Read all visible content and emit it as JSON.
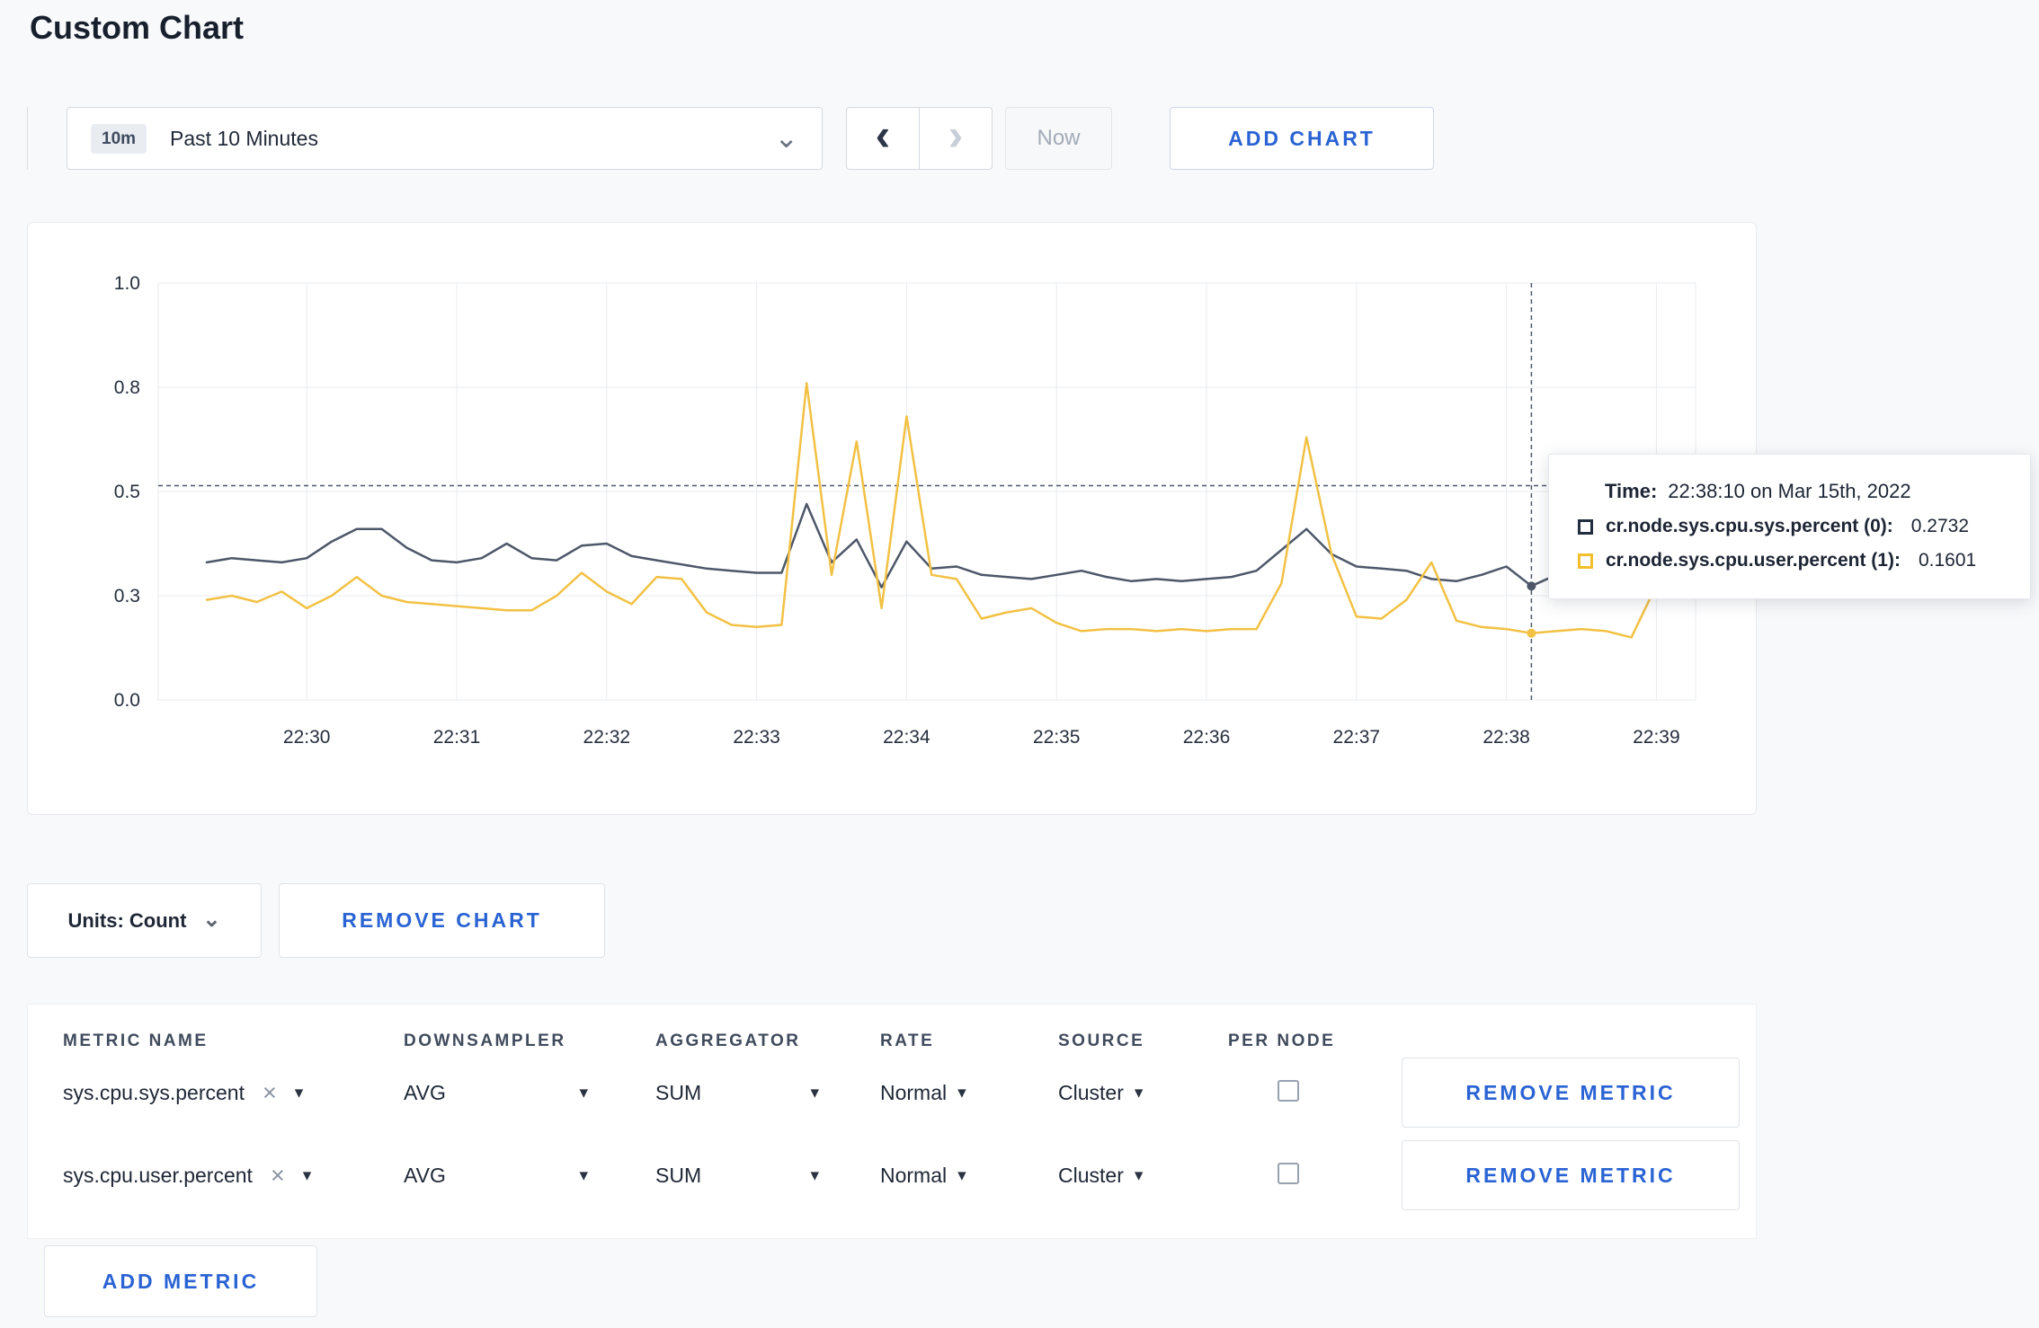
{
  "page": {
    "title": "Custom Chart"
  },
  "icons": {
    "chevron_down": "⌄",
    "chevron_left": "‹",
    "chevron_right": "›",
    "caret_down": "▾",
    "close": "×"
  },
  "toolbar": {
    "time_range": {
      "badge": "10m",
      "label": "Past 10 Minutes"
    },
    "now_label": "Now",
    "add_chart_label": "ADD CHART"
  },
  "chart_data": {
    "type": "line",
    "title": "",
    "xlabel": "",
    "ylabel": "",
    "ylim": [
      0,
      1
    ],
    "grid": true,
    "x_ticks": [
      "22:30",
      "22:31",
      "22:32",
      "22:33",
      "22:34",
      "22:35",
      "22:36",
      "22:37",
      "22:38",
      "22:39"
    ],
    "y_ticks": [
      {
        "value": 0.0,
        "label": "0.0"
      },
      {
        "value": 0.25,
        "label": "0.3"
      },
      {
        "value": 0.5,
        "label": "0.5"
      },
      {
        "value": 0.75,
        "label": "0.8"
      },
      {
        "value": 1.0,
        "label": "1.0"
      }
    ],
    "start_time": "22:29:20",
    "interval_seconds": 10,
    "series": [
      {
        "name": "cr.node.sys.cpu.sys.percent",
        "color": "#4d5769",
        "values": [
          0.33,
          0.34,
          0.335,
          0.33,
          0.34,
          0.38,
          0.41,
          0.41,
          0.365,
          0.335,
          0.33,
          0.34,
          0.375,
          0.34,
          0.335,
          0.37,
          0.375,
          0.345,
          0.335,
          0.325,
          0.315,
          0.31,
          0.305,
          0.305,
          0.47,
          0.33,
          0.385,
          0.27,
          0.38,
          0.315,
          0.32,
          0.3,
          0.295,
          0.29,
          0.3,
          0.31,
          0.295,
          0.285,
          0.29,
          0.285,
          0.29,
          0.295,
          0.31,
          0.36,
          0.41,
          0.35,
          0.32,
          0.315,
          0.31,
          0.29,
          0.285,
          0.3,
          0.32,
          0.2732,
          0.3,
          0.305,
          0.3,
          0.295,
          0.3,
          0.305
        ]
      },
      {
        "name": "cr.node.sys.cpu.user.percent",
        "color": "#f2c144",
        "values": [
          0.24,
          0.25,
          0.235,
          0.26,
          0.22,
          0.25,
          0.295,
          0.25,
          0.235,
          0.23,
          0.225,
          0.22,
          0.215,
          0.215,
          0.25,
          0.305,
          0.26,
          0.23,
          0.295,
          0.29,
          0.21,
          0.18,
          0.175,
          0.18,
          0.76,
          0.3,
          0.62,
          0.22,
          0.68,
          0.3,
          0.29,
          0.195,
          0.21,
          0.22,
          0.185,
          0.165,
          0.17,
          0.17,
          0.165,
          0.17,
          0.165,
          0.17,
          0.17,
          0.28,
          0.63,
          0.35,
          0.2,
          0.195,
          0.24,
          0.33,
          0.19,
          0.175,
          0.17,
          0.1601,
          0.165,
          0.17,
          0.165,
          0.15,
          0.275,
          0.255
        ]
      }
    ],
    "hover": {
      "index": 53,
      "time": "22:38:10",
      "guide_value": 0.514
    }
  },
  "tooltip": {
    "time_label": "Time:",
    "time_value": "22:38:10 on Mar 15th, 2022",
    "series": [
      {
        "name": "cr.node.sys.cpu.sys.percent (0):",
        "value": "0.2732",
        "color": "#232d3f"
      },
      {
        "name": "cr.node.sys.cpu.user.percent (1):",
        "value": "0.1601",
        "color": "#f2be2c"
      }
    ]
  },
  "chart_footer": {
    "units_label": "Units: Count",
    "remove_chart_label": "REMOVE CHART"
  },
  "metrics_table": {
    "headers": [
      "METRIC NAME",
      "DOWNSAMPLER",
      "AGGREGATOR",
      "RATE",
      "SOURCE",
      "PER NODE"
    ],
    "rows": [
      {
        "name": "sys.cpu.sys.percent",
        "downsampler": "AVG",
        "aggregator": "SUM",
        "rate": "Normal",
        "source": "Cluster",
        "per_node": false,
        "remove_label": "REMOVE METRIC"
      },
      {
        "name": "sys.cpu.user.percent",
        "downsampler": "AVG",
        "aggregator": "SUM",
        "rate": "Normal",
        "source": "Cluster",
        "per_node": false,
        "remove_label": "REMOVE METRIC"
      }
    ],
    "add_metric_label": "ADD METRIC"
  }
}
